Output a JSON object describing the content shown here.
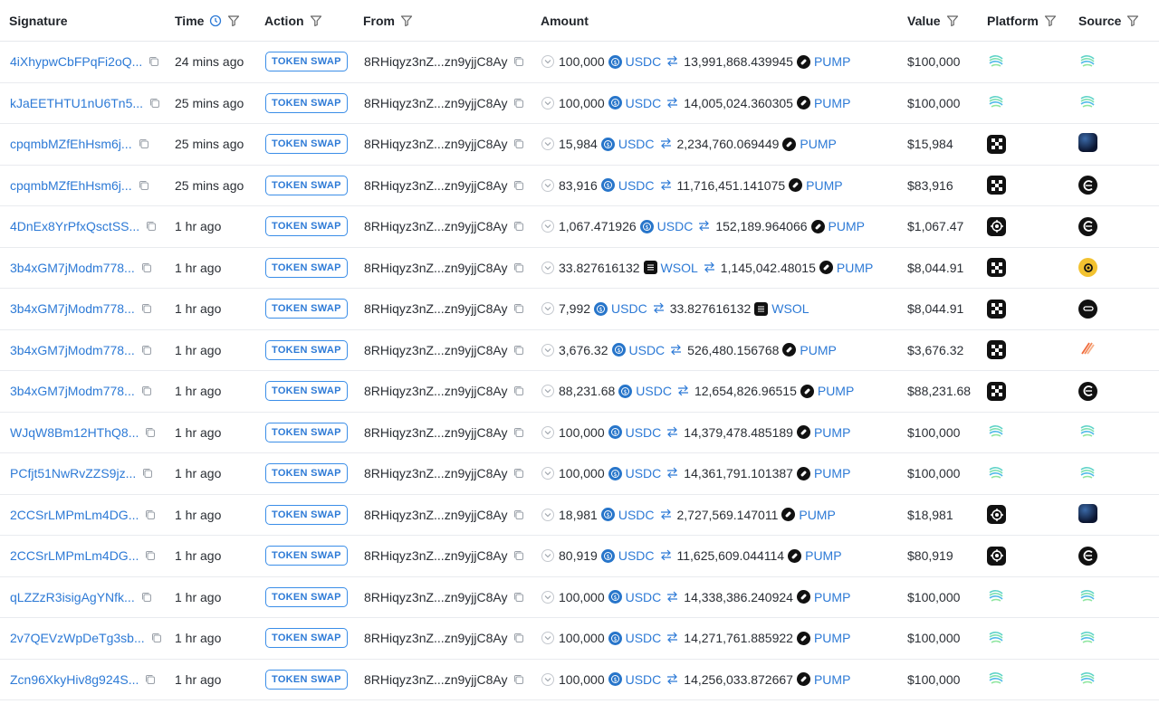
{
  "columns": {
    "signature": "Signature",
    "time": "Time",
    "action": "Action",
    "from": "From",
    "amount": "Amount",
    "value": "Value",
    "platform": "Platform",
    "source": "Source"
  },
  "header_icons": {
    "time": [
      "clock-icon",
      "filter-icon"
    ],
    "action": [
      "filter-icon"
    ],
    "from": [
      "filter-icon"
    ],
    "value": [
      "filter-icon"
    ],
    "platform": [
      "filter-icon"
    ],
    "source": [
      "filter-icon"
    ]
  },
  "colors": {
    "link": "#2d7ad6",
    "usdc": "#2775ca",
    "badge_border": "#3b8ee8"
  },
  "rows": [
    {
      "signature": "4iXhypwCbFPqFi2oQ...",
      "time": "24 mins ago",
      "action": "TOKEN SWAP",
      "from": "8RHiqyz3nZ...zn9yjjC8Ay",
      "in_amount": "100,000",
      "in_token": "USDC",
      "out_amount": "13,991,868.439945",
      "out_token": "PUMP",
      "value": "$100,000",
      "platform": "wave-icon",
      "source": "wave-icon"
    },
    {
      "signature": "kJaEETHTU1nU6Tn5...",
      "time": "25 mins ago",
      "action": "TOKEN SWAP",
      "from": "8RHiqyz3nZ...zn9yjjC8Ay",
      "in_amount": "100,000",
      "in_token": "USDC",
      "out_amount": "14,005,024.360305",
      "out_token": "PUMP",
      "value": "$100,000",
      "platform": "wave-icon",
      "source": "wave-icon"
    },
    {
      "signature": "cpqmbMZfEhHsm6j...",
      "time": "25 mins ago",
      "action": "TOKEN SWAP",
      "from": "8RHiqyz3nZ...zn9yjjC8Ay",
      "in_amount": "15,984",
      "in_token": "USDC",
      "out_amount": "2,234,760.069449",
      "out_token": "PUMP",
      "value": "$15,984",
      "platform": "okx-icon",
      "source": "sphere-icon"
    },
    {
      "signature": "cpqmbMZfEhHsm6j...",
      "time": "25 mins ago",
      "action": "TOKEN SWAP",
      "from": "8RHiqyz3nZ...zn9yjjC8Ay",
      "in_amount": "83,916",
      "in_token": "USDC",
      "out_amount": "11,716,451.141075",
      "out_token": "PUMP",
      "value": "$83,916",
      "platform": "okx-icon",
      "source": "c-logo-icon"
    },
    {
      "signature": "4DnEx8YrPfxQsctSS...",
      "time": "1 hr ago",
      "action": "TOKEN SWAP",
      "from": "8RHiqyz3nZ...zn9yjjC8Ay",
      "in_amount": "1,067.471926",
      "in_token": "USDC",
      "out_amount": "152,189.964066",
      "out_token": "PUMP",
      "value": "$1,067.47",
      "platform": "target-icon",
      "source": "c-logo-icon"
    },
    {
      "signature": "3b4xGM7jModm778...",
      "time": "1 hr ago",
      "action": "TOKEN SWAP",
      "from": "8RHiqyz3nZ...zn9yjjC8Ay",
      "in_amount": "33.827616132",
      "in_token": "WSOL",
      "out_amount": "1,145,042.48015",
      "out_token": "PUMP",
      "value": "$8,044.91",
      "platform": "okx-icon",
      "source": "ring-icon"
    },
    {
      "signature": "3b4xGM7jModm778...",
      "time": "1 hr ago",
      "action": "TOKEN SWAP",
      "from": "8RHiqyz3nZ...zn9yjjC8Ay",
      "in_amount": "7,992",
      "in_token": "USDC",
      "out_amount": "33.827616132",
      "out_token": "WSOL",
      "value": "$8,044.91",
      "platform": "okx-icon",
      "source": "pill-icon"
    },
    {
      "signature": "3b4xGM7jModm778...",
      "time": "1 hr ago",
      "action": "TOKEN SWAP",
      "from": "8RHiqyz3nZ...zn9yjjC8Ay",
      "in_amount": "3,676.32",
      "in_token": "USDC",
      "out_amount": "526,480.156768",
      "out_token": "PUMP",
      "value": "$3,676.32",
      "platform": "okx-icon",
      "source": "stripes-icon"
    },
    {
      "signature": "3b4xGM7jModm778...",
      "time": "1 hr ago",
      "action": "TOKEN SWAP",
      "from": "8RHiqyz3nZ...zn9yjjC8Ay",
      "in_amount": "88,231.68",
      "in_token": "USDC",
      "out_amount": "12,654,826.96515",
      "out_token": "PUMP",
      "value": "$88,231.68",
      "platform": "okx-icon",
      "source": "c-logo-icon"
    },
    {
      "signature": "WJqW8Bm12HThQ8...",
      "time": "1 hr ago",
      "action": "TOKEN SWAP",
      "from": "8RHiqyz3nZ...zn9yjjC8Ay",
      "in_amount": "100,000",
      "in_token": "USDC",
      "out_amount": "14,379,478.485189",
      "out_token": "PUMP",
      "value": "$100,000",
      "platform": "wave-icon",
      "source": "wave-icon"
    },
    {
      "signature": "PCfjt51NwRvZZS9jz...",
      "time": "1 hr ago",
      "action": "TOKEN SWAP",
      "from": "8RHiqyz3nZ...zn9yjjC8Ay",
      "in_amount": "100,000",
      "in_token": "USDC",
      "out_amount": "14,361,791.101387",
      "out_token": "PUMP",
      "value": "$100,000",
      "platform": "wave-icon",
      "source": "wave-icon"
    },
    {
      "signature": "2CCSrLMPmLm4DG...",
      "time": "1 hr ago",
      "action": "TOKEN SWAP",
      "from": "8RHiqyz3nZ...zn9yjjC8Ay",
      "in_amount": "18,981",
      "in_token": "USDC",
      "out_amount": "2,727,569.147011",
      "out_token": "PUMP",
      "value": "$18,981",
      "platform": "target-icon",
      "source": "sphere-icon"
    },
    {
      "signature": "2CCSrLMPmLm4DG...",
      "time": "1 hr ago",
      "action": "TOKEN SWAP",
      "from": "8RHiqyz3nZ...zn9yjjC8Ay",
      "in_amount": "80,919",
      "in_token": "USDC",
      "out_amount": "11,625,609.044114",
      "out_token": "PUMP",
      "value": "$80,919",
      "platform": "target-icon",
      "source": "c-logo-icon"
    },
    {
      "signature": "qLZZzR3isigAgYNfk...",
      "time": "1 hr ago",
      "action": "TOKEN SWAP",
      "from": "8RHiqyz3nZ...zn9yjjC8Ay",
      "in_amount": "100,000",
      "in_token": "USDC",
      "out_amount": "14,338,386.240924",
      "out_token": "PUMP",
      "value": "$100,000",
      "platform": "wave-icon",
      "source": "wave-icon"
    },
    {
      "signature": "2v7QEVzWpDeTg3sb...",
      "time": "1 hr ago",
      "action": "TOKEN SWAP",
      "from": "8RHiqyz3nZ...zn9yjjC8Ay",
      "in_amount": "100,000",
      "in_token": "USDC",
      "out_amount": "14,271,761.885922",
      "out_token": "PUMP",
      "value": "$100,000",
      "platform": "wave-icon",
      "source": "wave-icon"
    },
    {
      "signature": "Zcn96XkyHiv8g924S...",
      "time": "1 hr ago",
      "action": "TOKEN SWAP",
      "from": "8RHiqyz3nZ...zn9yjjC8Ay",
      "in_amount": "100,000",
      "in_token": "USDC",
      "out_amount": "14,256,033.872667",
      "out_token": "PUMP",
      "value": "$100,000",
      "platform": "wave-icon",
      "source": "wave-icon"
    }
  ]
}
